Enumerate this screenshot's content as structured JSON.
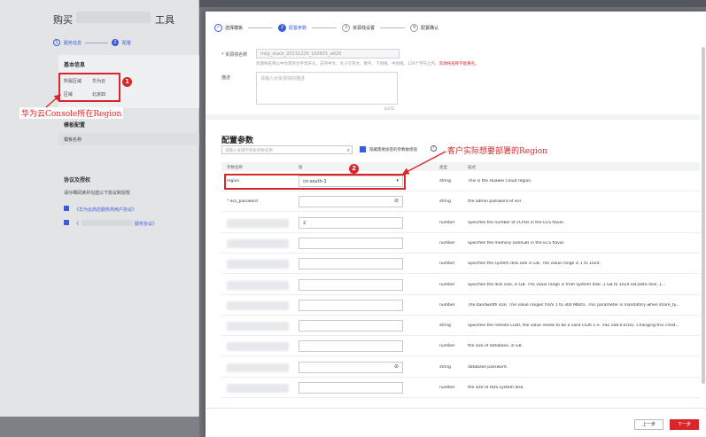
{
  "background": {
    "title_left": "购买",
    "title_right": "工具",
    "steps": [
      {
        "num": "1",
        "label": "服务信息"
      },
      {
        "num": "2",
        "label": "配置"
      }
    ],
    "basic_info_title": "基本信息",
    "basic_info_rows": [
      {
        "label": "所属区域",
        "value": "华为云"
      },
      {
        "label": "区域",
        "value": "北京四"
      }
    ],
    "template_title": "模板配置",
    "template_label": "模板名称",
    "agreement_title": "协议及授权",
    "agreement_hint": "请仔细阅读并勾选以下协议和授权",
    "agreement_links": [
      "《华为云商店服务商用户协议》",
      "《",
      "服务协议》"
    ]
  },
  "annotations": {
    "badge1": "1",
    "badge2": "2",
    "label1": "华为云Console所在Region",
    "label2": "客户实际想要部署的Region"
  },
  "wizard": [
    {
      "num": "✓",
      "label": "选择模板",
      "state": "done"
    },
    {
      "num": "2",
      "label": "配置参数",
      "state": "current"
    },
    {
      "num": "3",
      "label": "资源栈设置",
      "state": "todo"
    },
    {
      "num": "4",
      "label": "配置确认",
      "state": "todo"
    }
  ],
  "stack_form": {
    "name_label": "资源栈名称",
    "name_value": "mkp_stack_20231226_160831_a620",
    "name_hint": "资源栈名称以中文或英文字母开头，支持中文、大小写英文、数字、下划线、中划线，128个字符之内。",
    "name_hint_red": "资源栈名称不能重名。",
    "desc_label": "描述",
    "desc_placeholder": "请输入对资源栈的描述",
    "desc_count": "0/255"
  },
  "params": {
    "title": "配置参数",
    "search_placeholder": "请输入关键字搜索参数名称",
    "encrypt_label": "隐藏需要加密的参数敏感值",
    "help": "?",
    "columns": [
      "参数名称",
      "值",
      "类型",
      "描述"
    ],
    "rows": [
      {
        "name": "region",
        "required": false,
        "value": "cn-south-1",
        "control": "select",
        "type": "string",
        "desc": "This is the Huawei Cloud region."
      },
      {
        "name": "ecs_password",
        "required": true,
        "value": "",
        "control": "password",
        "type": "string",
        "desc": "the admin password of ecs"
      },
      {
        "name": "",
        "required": false,
        "value": "2",
        "control": "text",
        "type": "number",
        "desc": "Specifies the number of vCPUs in the ECS flavor."
      },
      {
        "name": "",
        "required": false,
        "value": "",
        "control": "text",
        "type": "number",
        "desc": "Specifies the memory size(GB) in the ECS flavor."
      },
      {
        "name": "",
        "required": false,
        "value": "",
        "control": "text",
        "type": "number",
        "desc": "Specifies the system disk size in GB. The value range is 1 to 1024."
      },
      {
        "name": "",
        "required": false,
        "value": "",
        "control": "text",
        "type": "number",
        "desc": "Specifies the disk size, in GB. The value range is from System disk: 1 GB to 1024 GB;Data disk: 1..."
      },
      {
        "name": "",
        "required": false,
        "value": "",
        "control": "text",
        "type": "number",
        "desc": "The bandwidth size. The value ranges from 1 to 300 Mbit/s. This parameter is mandatory when share_ty..."
      },
      {
        "name": "",
        "required": false,
        "value": "",
        "control": "text",
        "type": "string",
        "desc": "Specifies the remote CIDR, the value needs to be a valid CIDR (i.e. 192.168.0.0/16). Changing this creat..."
      },
      {
        "name": "",
        "required": false,
        "value": "",
        "control": "text",
        "type": "number",
        "desc": "the size of database, in GB."
      },
      {
        "name": "",
        "required": false,
        "value": "",
        "control": "password",
        "type": "string",
        "desc": "database password."
      },
      {
        "name": "",
        "required": false,
        "value": "",
        "control": "text",
        "type": "number",
        "desc": "the size of RDS system disk."
      }
    ]
  },
  "footer": {
    "prev": "上一步",
    "next": "下一步"
  },
  "colors": {
    "accent_blue": "#3b5bdb",
    "annotation_red": "#d8262b"
  }
}
